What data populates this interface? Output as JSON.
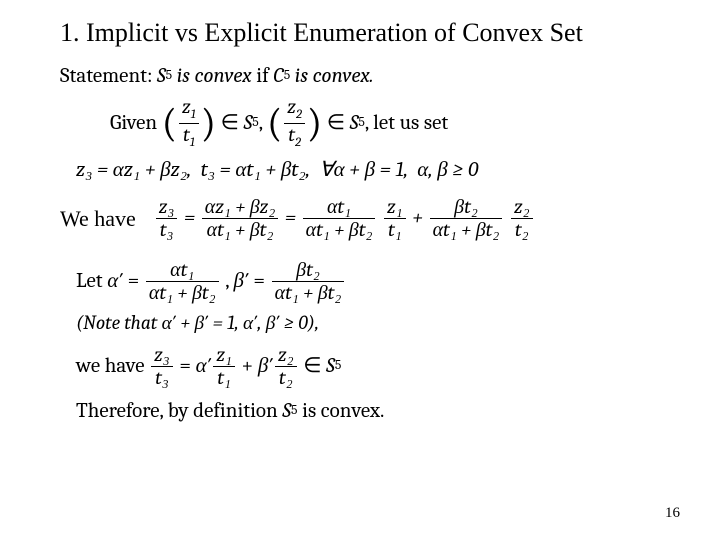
{
  "title": "1. Implicit vs Explicit Enumeration of Convex Set",
  "statement": {
    "prefix": "Statement: ",
    "s5": "S",
    "s5_sub": "5",
    "mid": " is convex ",
    "if": "if ",
    "c5": "C",
    "c5_sub": "5",
    "suffix": " is convex."
  },
  "given": {
    "given": "Given ",
    "z1": "z",
    "z1_sub": "1",
    "t1": "t",
    "t1_sub": "1",
    "in1": " ∈ ",
    "s5a": "S",
    "s5a_sub": "5",
    "comma1": ", ",
    "z2": "z",
    "z2_sub": "2",
    "t2": "t",
    "t2_sub": "2",
    "in2": " ∈ ",
    "s5b": "S",
    "s5b_sub": "5",
    "tail": ", let us set"
  },
  "defs": "z₃ = αz₁ + βz₂,  t₃ = αt₁ + βt₂,  ∀α + β = 1,  α, β ≥ 0",
  "we_have_label": "We have",
  "eq1": {
    "lhs_num": "z₃",
    "lhs_den": "t₃",
    "eq1": " = ",
    "f1_num": "αz₁ + βz₂",
    "f1_den": "αt₁ + βt₂",
    "eq2": " = ",
    "f2_num": "αt₁",
    "f2_den": "αt₁ + βt₂",
    "mul1": " ",
    "f3_num": "z₁",
    "f3_den": "t₁",
    "plus": " + ",
    "f4_num": "βt₂",
    "f4_den": "αt₁ + βt₂",
    "mul2": " ",
    "f5_num": "z₂",
    "f5_den": "t₂"
  },
  "let_line": {
    "let": "Let ",
    "a": "α′",
    "eq1": " = ",
    "f1_num": "αt₁",
    "f1_den": "αt₁ + βt₂",
    "comma": " , ",
    "b": "β′",
    "eq2": " = ",
    "f2_num": "βt₂",
    "f2_den": "αt₁ + βt₂"
  },
  "note": "(Note that α′ + β′ = 1, α′, β′ ≥ 0),",
  "result": {
    "prefix": "we have ",
    "lhs_num": "z₃",
    "lhs_den": "t₃",
    "eq": " = ",
    "a": "α′",
    "f1_num": "z₁",
    "f1_den": "t₁",
    "plus": " + ",
    "b": "β′",
    "f2_num": "z₂",
    "f2_den": "t₂",
    "in": " ∈ ",
    "s5": "S",
    "s5_sub": "5"
  },
  "therefore": {
    "prefix": "Therefore, by definition ",
    "s5": "S",
    "s5_sub": "5",
    "suffix": " is convex."
  },
  "page": "16"
}
